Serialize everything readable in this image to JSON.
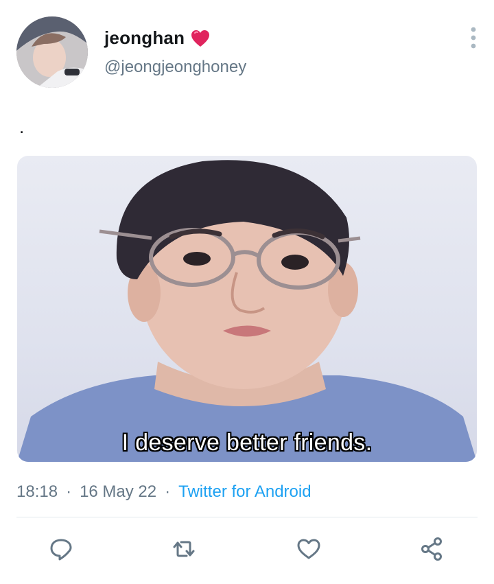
{
  "tweet": {
    "user": {
      "display_name": "jeonghan",
      "handle": "@jeongjeonghoney",
      "name_emoji": "heart-icon"
    },
    "text": ".",
    "media": {
      "caption": "I deserve better friends."
    },
    "meta": {
      "time": "18:18",
      "separator": "·",
      "date": "16 May 22",
      "source": "Twitter for Android"
    },
    "actions": [
      "reply-icon",
      "retweet-icon",
      "like-icon",
      "share-icon"
    ]
  },
  "colors": {
    "text": "#14171a",
    "secondary": "#657786",
    "link": "#1da1f2",
    "heart": "#e0245e",
    "divider": "#e1e8ed"
  }
}
